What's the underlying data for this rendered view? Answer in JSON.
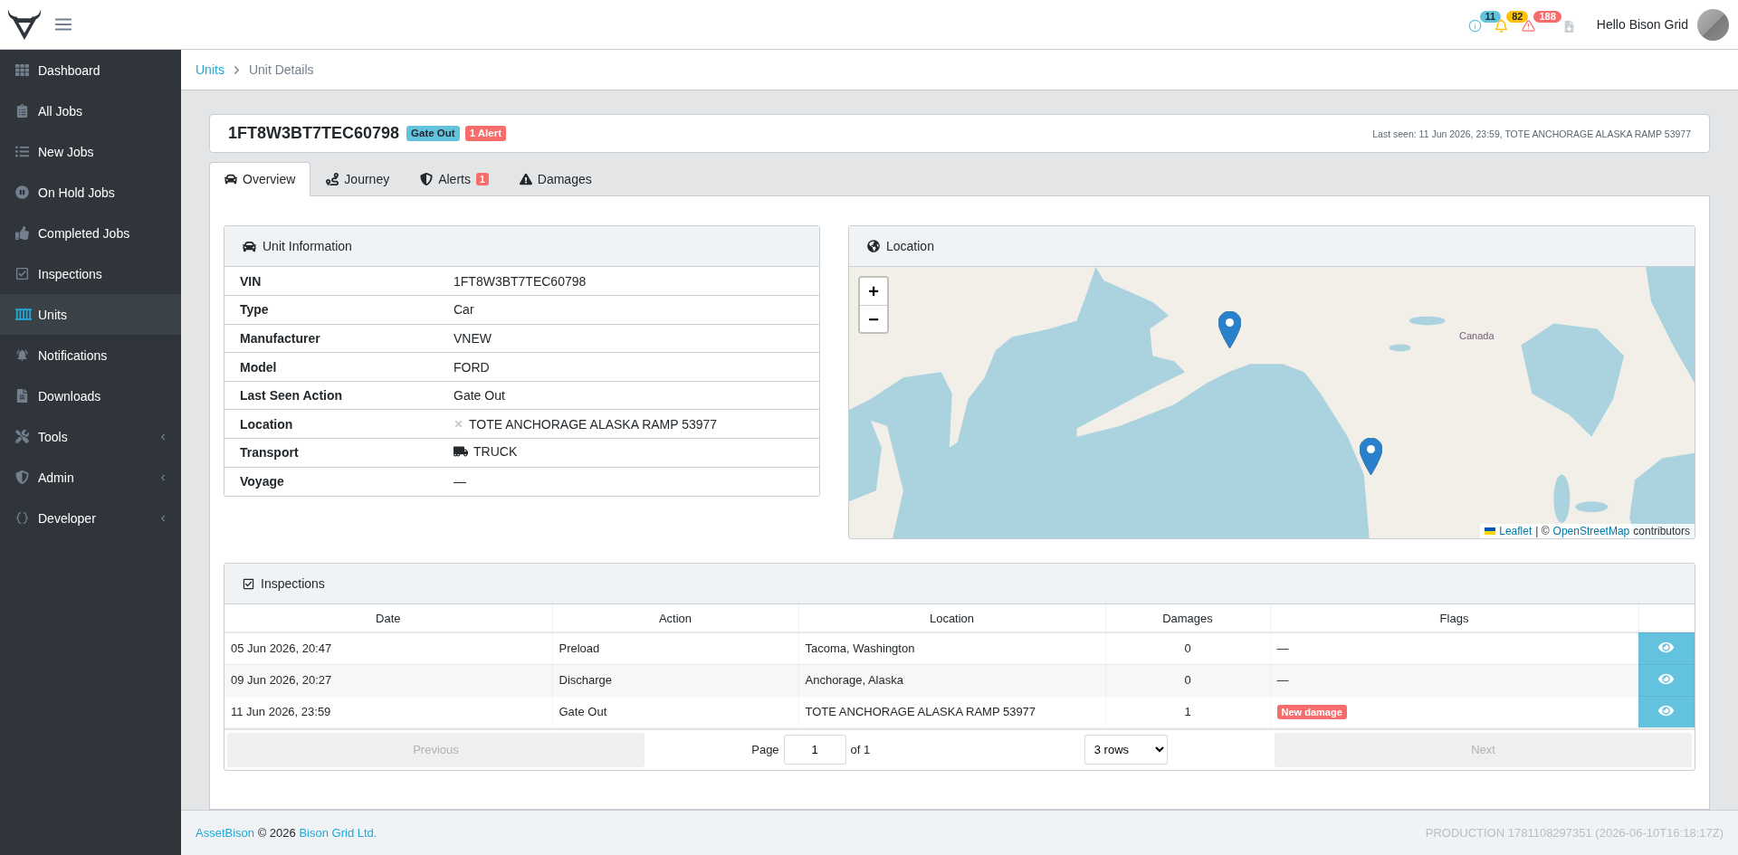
{
  "header": {
    "notifications": [
      {
        "kind": "info",
        "count": "11"
      },
      {
        "kind": "bell",
        "count": "82"
      },
      {
        "kind": "warning",
        "count": "188"
      }
    ],
    "greeting": "Hello Bison Grid"
  },
  "sidebar": {
    "items": [
      {
        "label": "Dashboard",
        "selected": false,
        "expandable": false
      },
      {
        "label": "All Jobs",
        "selected": false,
        "expandable": false
      },
      {
        "label": "New Jobs",
        "selected": false,
        "expandable": false
      },
      {
        "label": "On Hold Jobs",
        "selected": false,
        "expandable": false
      },
      {
        "label": "Completed Jobs",
        "selected": false,
        "expandable": false
      },
      {
        "label": "Inspections",
        "selected": false,
        "expandable": false
      },
      {
        "label": "Units",
        "selected": true,
        "expandable": false
      },
      {
        "label": "Notifications",
        "selected": false,
        "expandable": false
      },
      {
        "label": "Downloads",
        "selected": false,
        "expandable": false
      },
      {
        "label": "Tools",
        "selected": false,
        "expandable": true
      },
      {
        "label": "Admin",
        "selected": false,
        "expandable": true
      },
      {
        "label": "Developer",
        "selected": false,
        "expandable": true
      }
    ]
  },
  "breadcrumb": {
    "link": "Units",
    "current": "Unit Details"
  },
  "unit": {
    "vin": "1FT8W3BT7TEC60798",
    "badges": [
      {
        "label": "Gate Out",
        "color": "#63c2de"
      },
      {
        "label": "1 Alert",
        "color": "#f86c6b"
      }
    ],
    "last_seen": "Last seen: 11 Jun 2026, 23:59, TOTE ANCHORAGE ALASKA RAMP 53977"
  },
  "tabs": [
    {
      "label": "Overview",
      "selected": true
    },
    {
      "label": "Journey",
      "selected": false
    },
    {
      "label": "Alerts",
      "selected": false,
      "badge": "1"
    },
    {
      "label": "Damages",
      "selected": false
    }
  ],
  "unit_information": {
    "title": "Unit Information",
    "rows": [
      {
        "label": "VIN",
        "value": "1FT8W3BT7TEC60798",
        "kind": "text"
      },
      {
        "label": "Type",
        "value": "Car",
        "kind": "text"
      },
      {
        "label": "Manufacturer",
        "value": "VNEW",
        "kind": "text"
      },
      {
        "label": "Model",
        "value": "FORD",
        "kind": "text"
      },
      {
        "label": "Last Seen Action",
        "value": "Gate Out",
        "kind": "text"
      },
      {
        "label": "Location",
        "value": "TOTE ANCHORAGE ALASKA RAMP 53977",
        "kind": "location"
      },
      {
        "label": "Transport",
        "value": "TRUCK",
        "kind": "transport"
      },
      {
        "label": "Voyage",
        "value": "—",
        "kind": "text"
      }
    ]
  },
  "location": {
    "title": "Location",
    "map": {
      "zoom_in": "+",
      "zoom_out": "−",
      "place_label": "Canada",
      "attribution": {
        "leaflet": "Leaflet",
        "middle": "| ©",
        "osm": "OpenStreetMap",
        "suffix": "contributors"
      }
    }
  },
  "inspections": {
    "title": "Inspections",
    "columns": [
      "Date",
      "Action",
      "Location",
      "Damages",
      "Flags"
    ],
    "rows": [
      {
        "date": "05 Jun 2026, 20:47",
        "action": "Preload",
        "location": "Tacoma, Washington",
        "damages": "0",
        "flag": {
          "kind": "dash",
          "label": "—"
        }
      },
      {
        "date": "09 Jun 2026, 20:27",
        "action": "Discharge",
        "location": "Anchorage, Alaska",
        "damages": "0",
        "flag": {
          "kind": "dash",
          "label": "—"
        }
      },
      {
        "date": "11 Jun 2026, 23:59",
        "action": "Gate Out",
        "location": "TOTE ANCHORAGE ALASKA RAMP 53977",
        "damages": "1",
        "flag": {
          "kind": "badge",
          "label": "New damage"
        }
      }
    ],
    "pagination": {
      "previous": {
        "label": "Previous",
        "disabled": true
      },
      "page_label": "Page",
      "page": "1",
      "page_total": "of 1",
      "rows": "3 rows",
      "next": {
        "label": "Next",
        "disabled": true
      }
    }
  },
  "footer": {
    "brand": "AssetBison",
    "middle": "© 2026",
    "company": "Bison Grid Ltd.",
    "build": "PRODUCTION 1781108297351 (2026-06-10T16:18:17Z)"
  }
}
